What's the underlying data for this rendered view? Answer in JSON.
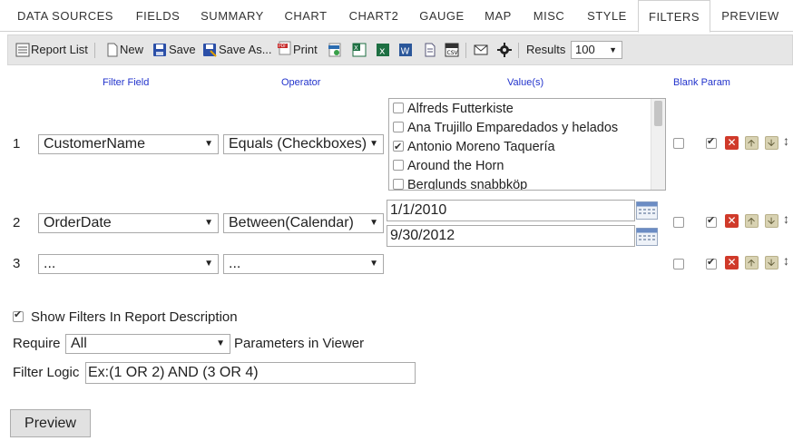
{
  "tabs": [
    {
      "label": "DATA SOURCES",
      "active": false
    },
    {
      "label": "FIELDS",
      "active": false
    },
    {
      "label": "SUMMARY",
      "active": false
    },
    {
      "label": "CHART",
      "active": false
    },
    {
      "label": "CHART2",
      "active": false
    },
    {
      "label": "GAUGE",
      "active": false
    },
    {
      "label": "MAP",
      "active": false
    },
    {
      "label": "MISC",
      "active": false
    },
    {
      "label": "STYLE",
      "active": false
    },
    {
      "label": "FILTERS",
      "active": true
    },
    {
      "label": "PREVIEW",
      "active": false
    }
  ],
  "toolbar": {
    "report_list": "Report List",
    "new": "New",
    "save": "Save",
    "save_as": "Save As...",
    "print": "Print",
    "results_label": "Results",
    "results_value": "100",
    "caret": "▼",
    "icons": [
      "report-list-icon",
      "new-doc-icon",
      "save-icon",
      "save-as-icon",
      "pdf-print-icon",
      "html-export-icon",
      "excel-export-icon",
      "excel-icon",
      "word-icon",
      "document-icon",
      "csv-icon",
      "email-icon",
      "gear-icon"
    ]
  },
  "headers": {
    "filter_field": "Filter Field",
    "operator": "Operator",
    "values": "Value(s)",
    "blank_param": "Blank Param"
  },
  "filters": [
    {
      "num": "1",
      "field": "CustomerName",
      "operator": "Equals (Checkboxes)",
      "options": [
        {
          "label": "Alfreds Futterkiste",
          "checked": false
        },
        {
          "label": "Ana Trujillo Emparedados y helados",
          "checked": false
        },
        {
          "label": "Antonio Moreno Taquería",
          "checked": true
        },
        {
          "label": "Around the Horn",
          "checked": false
        },
        {
          "label": "Berglunds snabbköp",
          "checked": false
        }
      ],
      "blank_param": false,
      "enabled": true
    },
    {
      "num": "2",
      "field": "OrderDate",
      "operator": "Between(Calendar)",
      "value_from": "1/1/2010",
      "value_to": "9/30/2012",
      "blank_param": false,
      "enabled": true
    },
    {
      "num": "3",
      "field": "...",
      "operator": "...",
      "blank_param": false,
      "enabled": true
    }
  ],
  "options": {
    "show_filters_label": "Show Filters In Report Description",
    "show_filters_checked": true,
    "require_label": "Require",
    "require_value": "All",
    "require_suffix": "Parameters in Viewer",
    "filter_logic_label": "Filter Logic",
    "filter_logic_placeholder": "Ex:(1 OR 2) AND (3 OR 4)"
  },
  "preview_button": "Preview",
  "delete_glyph": "✕",
  "sort_glyph": "↕",
  "colors": {
    "header_blue": "#2233cc",
    "delete_red": "#d03a2a",
    "toolbar_bg": "#e6e6e6"
  }
}
